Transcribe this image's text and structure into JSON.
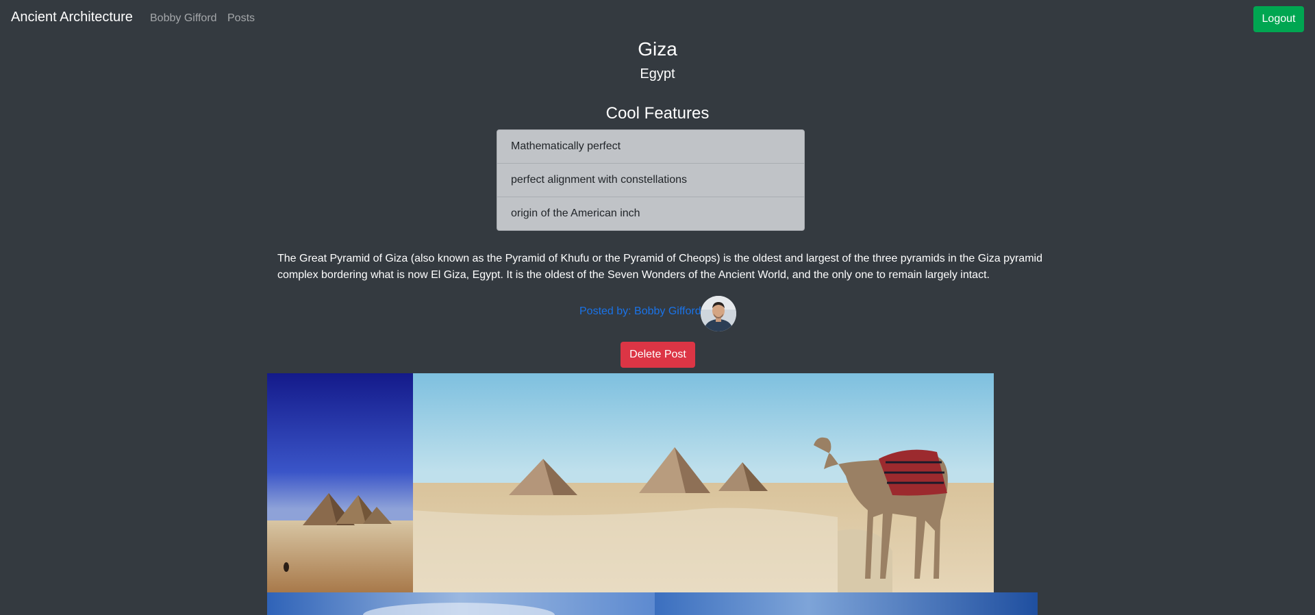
{
  "navbar": {
    "brand": "Ancient Architecture",
    "user_link": "Bobby Gifford",
    "posts_link": "Posts",
    "logout_label": "Logout"
  },
  "post": {
    "title": "Giza",
    "country": "Egypt",
    "features_heading": "Cool Features",
    "features": [
      "Mathematically perfect",
      "perfect alignment with constellations",
      "origin of the American inch"
    ],
    "description": "The Great Pyramid of Giza (also known as the Pyramid of Khufu or the Pyramid of Cheops) is the oldest and largest of the three pyramids in the Giza pyramid complex bordering what is now El Giza, Egypt. It is the oldest of the Seven Wonders of the Ancient World, and the only one to remain largely intact.",
    "posted_by": "Posted by: Bobby Gifford",
    "delete_label": "Delete Post"
  },
  "colors": {
    "background": "#343a40",
    "logout_button": "#00a651",
    "delete_button": "#dc3545",
    "link": "#1a73e8",
    "features_bg": "#c0c3c7"
  }
}
